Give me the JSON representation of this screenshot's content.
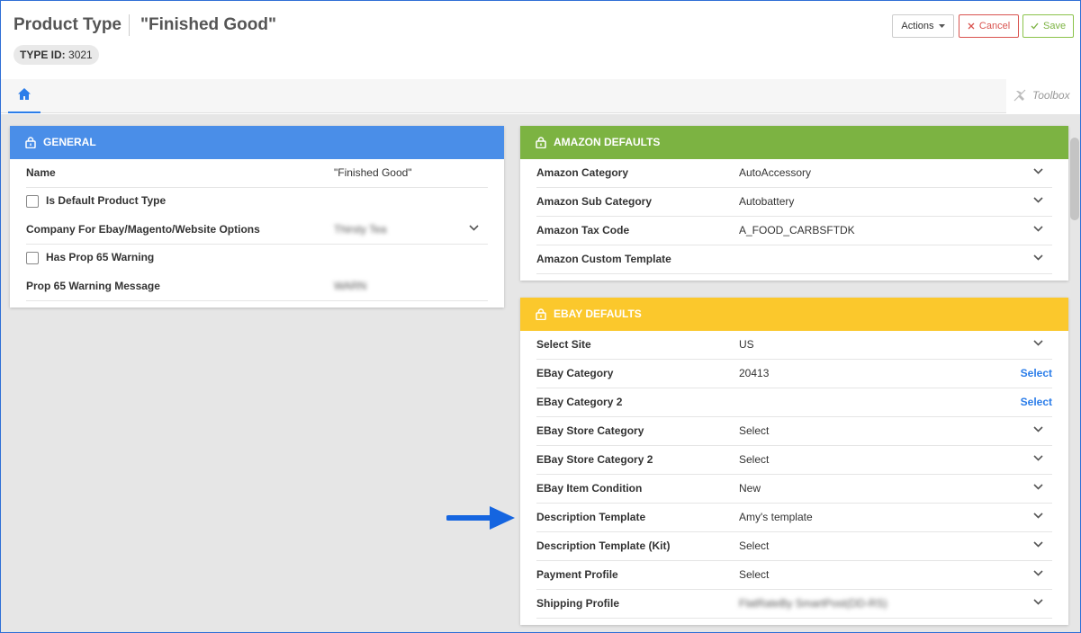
{
  "header": {
    "title": "Product Type",
    "subtitle": "\"Finished Good\"",
    "type_id_label": "TYPE ID:",
    "type_id_value": "3021"
  },
  "toolbar": {
    "actions_label": "Actions",
    "cancel_label": "Cancel",
    "save_label": "Save",
    "toolbox_label": "Toolbox"
  },
  "colors": {
    "general": "#4a8ee8",
    "amazon": "#7cb342",
    "ebay": "#fbc82c",
    "link": "#2b7de9"
  },
  "general": {
    "title": "GENERAL",
    "name_label": "Name",
    "name_value": "\"Finished Good\"",
    "default_label": "Is Default Product Type",
    "company_label": "Company For Ebay/Magento/Website Options",
    "company_value": "Thirsty Tea",
    "prop65_label": "Has Prop 65 Warning",
    "prop65_msg_label": "Prop 65 Warning Message",
    "prop65_msg_value": "WARN"
  },
  "amazon": {
    "title": "AMAZON DEFAULTS",
    "rows": [
      {
        "label": "Amazon Category",
        "value": "AutoAccessory"
      },
      {
        "label": "Amazon Sub Category",
        "value": "Autobattery"
      },
      {
        "label": "Amazon Tax Code",
        "value": "A_FOOD_CARBSFTDK"
      },
      {
        "label": "Amazon Custom Template",
        "value": ""
      }
    ]
  },
  "ebay": {
    "title": "EBAY DEFAULTS",
    "rows": [
      {
        "label": "Select Site",
        "value": "US"
      },
      {
        "label": "EBay Category",
        "value": "20413",
        "link": "Select"
      },
      {
        "label": "EBay Category 2",
        "value": "",
        "link": "Select"
      },
      {
        "label": "EBay Store Category",
        "value": "Select"
      },
      {
        "label": "EBay Store Category 2",
        "value": "Select"
      },
      {
        "label": "EBay Item Condition",
        "value": "New"
      },
      {
        "label": "Description Template",
        "value": "Amy's template"
      },
      {
        "label": "Description Template (Kit)",
        "value": "Select"
      },
      {
        "label": "Payment Profile",
        "value": "Select"
      },
      {
        "label": "Shipping Profile",
        "value": "FlatRateBy SmartPost(DD-RS)"
      }
    ]
  }
}
